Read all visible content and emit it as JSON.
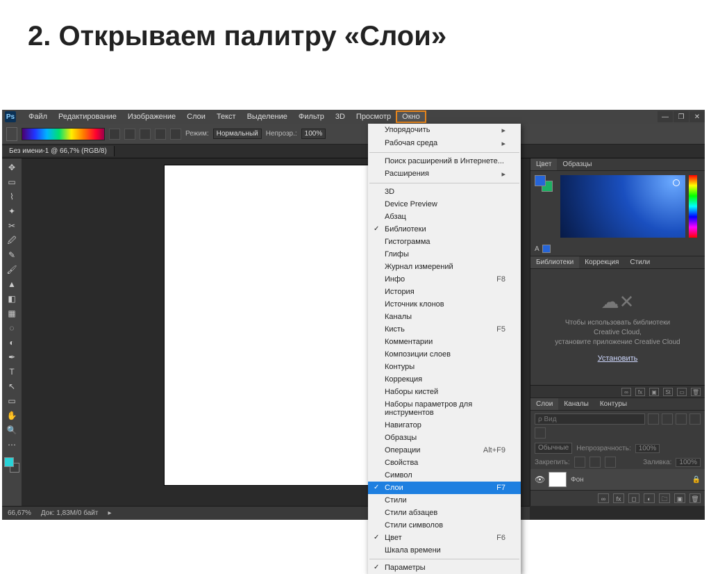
{
  "slide_title": "2. Открываем палитру «Слои»",
  "menubar": {
    "logo": "Ps",
    "items": [
      "Файл",
      "Редактирование",
      "Изображение",
      "Слои",
      "Текст",
      "Выделение",
      "Фильтр",
      "3D",
      "Просмотр",
      "Окно"
    ],
    "active_index": 9
  },
  "options_bar": {
    "mode_label": "Режим:",
    "mode_value": "Нормальный",
    "opacity_label": "Непрозр.:",
    "opacity_value": "100%"
  },
  "document_tab": "Без имени-1 @ 66,7% (RGB/8)",
  "dropdown": {
    "items": [
      {
        "label": "Упорядочить",
        "submenu": true
      },
      {
        "label": "Рабочая среда",
        "submenu": true
      },
      {
        "sep": true
      },
      {
        "label": "Поиск расширений в Интернете..."
      },
      {
        "label": "Расширения",
        "submenu": true
      },
      {
        "sep": true
      },
      {
        "label": "3D"
      },
      {
        "label": "Device Preview"
      },
      {
        "label": "Абзац"
      },
      {
        "label": "Библиотеки",
        "checked": true
      },
      {
        "label": "Гистограмма"
      },
      {
        "label": "Глифы"
      },
      {
        "label": "Журнал измерений"
      },
      {
        "label": "Инфо",
        "shortcut": "F8"
      },
      {
        "label": "История"
      },
      {
        "label": "Источник клонов"
      },
      {
        "label": "Каналы"
      },
      {
        "label": "Кисть",
        "shortcut": "F5"
      },
      {
        "label": "Комментарии"
      },
      {
        "label": "Композиции слоев"
      },
      {
        "label": "Контуры"
      },
      {
        "label": "Коррекция"
      },
      {
        "label": "Наборы кистей"
      },
      {
        "label": "Наборы параметров для инструментов"
      },
      {
        "label": "Навигатор"
      },
      {
        "label": "Образцы"
      },
      {
        "label": "Операции",
        "shortcut": "Alt+F9"
      },
      {
        "label": "Свойства"
      },
      {
        "label": "Символ"
      },
      {
        "label": "Слои",
        "shortcut": "F7",
        "checked": true,
        "selected": true
      },
      {
        "label": "Стили"
      },
      {
        "label": "Стили абзацев"
      },
      {
        "label": "Стили символов"
      },
      {
        "label": "Цвет",
        "shortcut": "F6",
        "checked": true
      },
      {
        "label": "Шкала времени"
      },
      {
        "sep": true
      },
      {
        "label": "Параметры",
        "checked": true
      }
    ]
  },
  "color_panel": {
    "tabs": [
      "Цвет",
      "Образцы"
    ],
    "active": 0,
    "char": "A"
  },
  "library_panel": {
    "tabs": [
      "Библиотеки",
      "Коррекция",
      "Стили"
    ],
    "active": 0,
    "line1": "Чтобы использовать библиотеки",
    "line2": "Creative Cloud,",
    "line3": "установите приложение Creative Cloud",
    "link": "Установить"
  },
  "layers_panel": {
    "tabs": [
      "Слои",
      "Каналы",
      "Контуры"
    ],
    "active": 0,
    "kind_placeholder": "ρ Вид",
    "blend_value": "Обычные",
    "opacity_label": "Непрозрачность:",
    "opacity_value": "100%",
    "lock_label": "Закрепить:",
    "fill_label": "Заливка:",
    "fill_value": "100%",
    "layer_name": "Фон"
  },
  "status": {
    "zoom": "66,67%",
    "doc": "Док: 1,83M/0 байт"
  },
  "colors": {
    "accent": "#e8861c",
    "selection": "#1e7fe0"
  }
}
